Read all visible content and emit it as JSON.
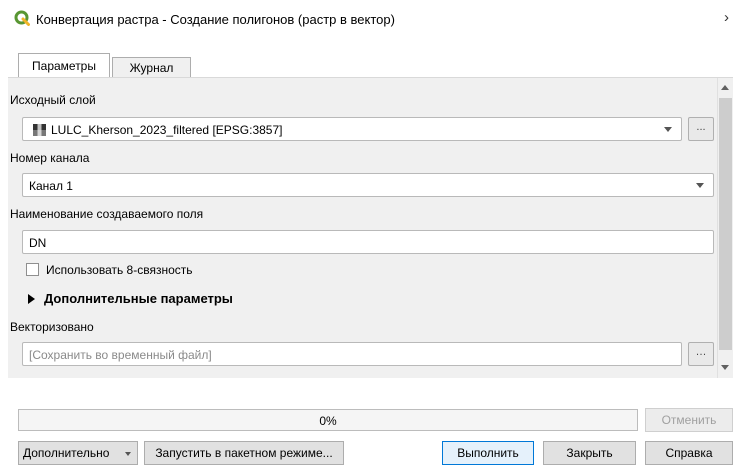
{
  "window": {
    "title": "Конвертация растра - Создание полигонов (растр в вектор)",
    "close_glyph": "›",
    "icon": "qgis-icon",
    "accent_color": "#589632"
  },
  "tabs": [
    {
      "label": "Параметры",
      "active": true
    },
    {
      "label": "Журнал",
      "active": false
    }
  ],
  "params": {
    "input_layer": {
      "label": "Исходный слой",
      "value": "LULC_Kherson_2023_filtered [EPSG:3857]",
      "browse_label": "..."
    },
    "band": {
      "label": "Номер канала",
      "value": "Канал 1"
    },
    "field_name": {
      "label": "Наименование создаваемого поля",
      "value": "DN"
    },
    "eight_connectedness": {
      "label": "Использовать 8-связность",
      "checked": false
    },
    "advanced_section": {
      "label": "Дополнительные параметры"
    },
    "output": {
      "label": "Векторизовано",
      "placeholder": "[Сохранить во временный файл]",
      "browse_label": "…"
    }
  },
  "progress": {
    "value": 0,
    "text": "0%"
  },
  "buttons": {
    "cancel": "Отменить",
    "advanced": "Дополнительно",
    "batch": "Запустить в пакетном режиме...",
    "run": "Выполнить",
    "close": "Закрыть",
    "help": "Справка"
  }
}
